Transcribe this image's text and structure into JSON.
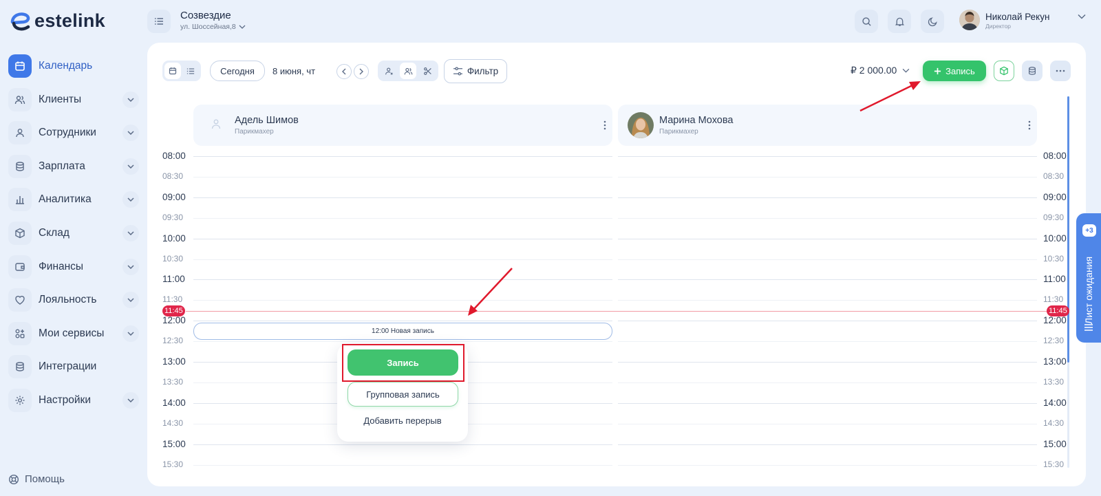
{
  "app": {
    "logo_text": "estelink"
  },
  "header": {
    "org_title": "Созвездие",
    "org_address": "ул. Шоссейная,8",
    "user_name": "Николай Рекун",
    "user_role": "Директор"
  },
  "sidebar": {
    "items": [
      {
        "label": "Календарь",
        "icon": "calendar-icon",
        "active": true
      },
      {
        "label": "Клиенты",
        "icon": "users-icon"
      },
      {
        "label": "Сотрудники",
        "icon": "user-icon"
      },
      {
        "label": "Зарплата",
        "icon": "coins-icon"
      },
      {
        "label": "Аналитика",
        "icon": "chart-icon"
      },
      {
        "label": "Склад",
        "icon": "box-icon"
      },
      {
        "label": "Финансы",
        "icon": "wallet-icon"
      },
      {
        "label": "Лояльность",
        "icon": "heart-icon"
      },
      {
        "label": "Мои сервисы",
        "icon": "apps-icon"
      },
      {
        "label": "Интеграции",
        "icon": "database-icon"
      },
      {
        "label": "Настройки",
        "icon": "gear-icon"
      }
    ],
    "help_label": "Помощь"
  },
  "toolbar": {
    "today_label": "Сегодня",
    "date_label": "8 июня, чт",
    "filter_label": "Фильтр",
    "revenue": "₽ 2 000.00",
    "add_label": "Запись"
  },
  "staff": [
    {
      "name": "Адель Шимов",
      "role": "Парикмахер"
    },
    {
      "name": "Марина Мохова",
      "role": "Парикмахер"
    }
  ],
  "times": [
    "08:00",
    "08:30",
    "09:00",
    "09:30",
    "10:00",
    "10:30",
    "11:00",
    "11:30",
    "12:00",
    "12:30",
    "13:00",
    "13:30",
    "14:00",
    "14:30",
    "15:00",
    "15:30"
  ],
  "now_time": "11:45",
  "new_entry_label": "12:00 Новая запись",
  "popup": {
    "primary": "Запись",
    "secondary": "Групповая запись",
    "tertiary": "Добавить перерыв"
  },
  "waitlist": {
    "label": "Лист ожидания",
    "badge": "+3"
  },
  "colors": {
    "accent": "#3f78e8",
    "green": "#34c36b",
    "now": "#e0264a",
    "annotation": "#e0192c"
  }
}
